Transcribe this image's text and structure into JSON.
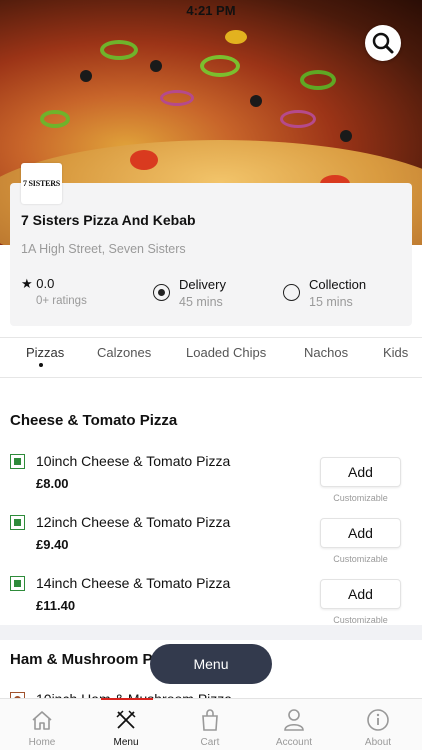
{
  "status_bar": {
    "time": "4:21 PM"
  },
  "restaurant": {
    "logo_text": "7 SISTERS",
    "name": "7 Sisters Pizza And Kebab",
    "address": "1A High Street, Seven Sisters",
    "rating": "★ 0.0",
    "ratings_count": "0+ ratings"
  },
  "order_options": [
    {
      "label": "Delivery",
      "time": "45 mins",
      "selected": true
    },
    {
      "label": "Collection",
      "time": "15 mins",
      "selected": false
    }
  ],
  "tabs": [
    "Pizzas",
    "Calzones",
    "Loaded Chips",
    "Nachos",
    "Kids"
  ],
  "active_tab": "Pizzas",
  "sections": [
    {
      "title": "Cheese & Tomato Pizza",
      "items": [
        {
          "name": "10inch Cheese & Tomato Pizza",
          "price": "£8.00",
          "button": "Add",
          "note": "Customizable"
        },
        {
          "name": "12inch Cheese & Tomato Pizza",
          "price": "£9.40",
          "button": "Add",
          "note": "Customizable"
        },
        {
          "name": "14inch Cheese & Tomato Pizza",
          "price": "£11.40",
          "button": "Add",
          "note": "Customizable"
        }
      ]
    },
    {
      "title": "Ham & Mushroom Pizza",
      "items": [
        {
          "name": "10inch Ham & Mushroom Pizza"
        }
      ]
    }
  ],
  "floating_menu_label": "Menu",
  "bottom_nav": [
    {
      "label": "Home",
      "icon": "home-icon"
    },
    {
      "label": "Menu",
      "icon": "fork-knife-icon",
      "active": true
    },
    {
      "label": "Cart",
      "icon": "shopping-bag-icon"
    },
    {
      "label": "Account",
      "icon": "person-icon"
    },
    {
      "label": "About",
      "icon": "info-icon"
    }
  ],
  "colors": {
    "accent_red": "#d9231e",
    "veg_green": "#2e8b3a",
    "fab_bg": "#333a4d"
  }
}
